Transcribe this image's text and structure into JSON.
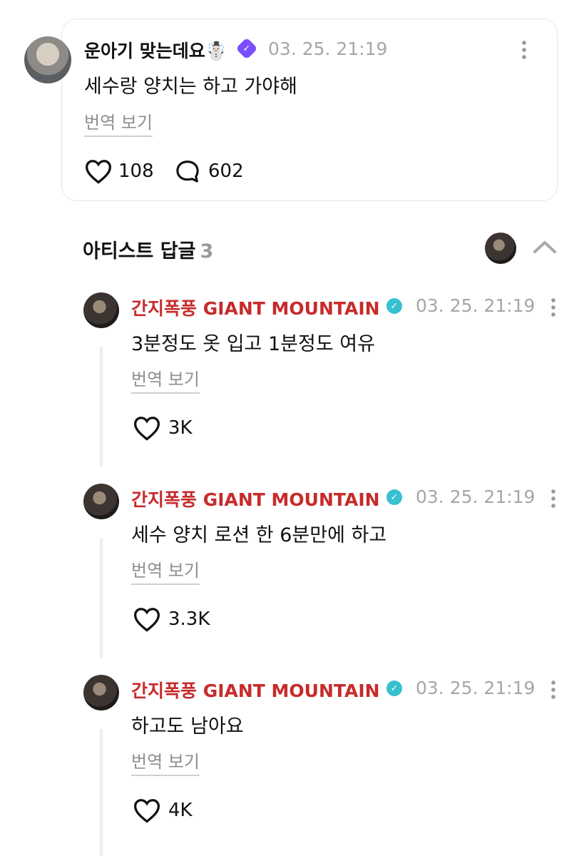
{
  "post": {
    "username": "운아기 맞는데요☃️",
    "timestamp": "03. 25. 21:19",
    "text": "세수랑 양치는 하고 가야해",
    "translate_label": "번역 보기",
    "likes": "108",
    "comments": "602",
    "badge_icon": "verified-badge-icon",
    "badge_color": "#7b4dff"
  },
  "artist_section": {
    "title": "아티스트 답글",
    "count": "3"
  },
  "replies": [
    {
      "author": "간지폭풍 GIANT MOUNTAIN",
      "timestamp": "03. 25. 21:19",
      "text": "3분정도 옷 입고 1분정도 여유",
      "translate_label": "번역 보기",
      "likes": "3K"
    },
    {
      "author": "간지폭풍 GIANT MOUNTAIN",
      "timestamp": "03. 25. 21:19",
      "text": "세수 양치 로션 한 6분만에 하고",
      "translate_label": "번역 보기",
      "likes": "3.3K"
    },
    {
      "author": "간지폭풍 GIANT MOUNTAIN",
      "timestamp": "03. 25. 21:19",
      "text": "하고도 남아요",
      "translate_label": "번역 보기",
      "likes": "4K"
    }
  ],
  "colors": {
    "artist_name": "#c72b2b",
    "artist_badge": "#37c0cf",
    "muted_text": "#a6a6a6"
  }
}
